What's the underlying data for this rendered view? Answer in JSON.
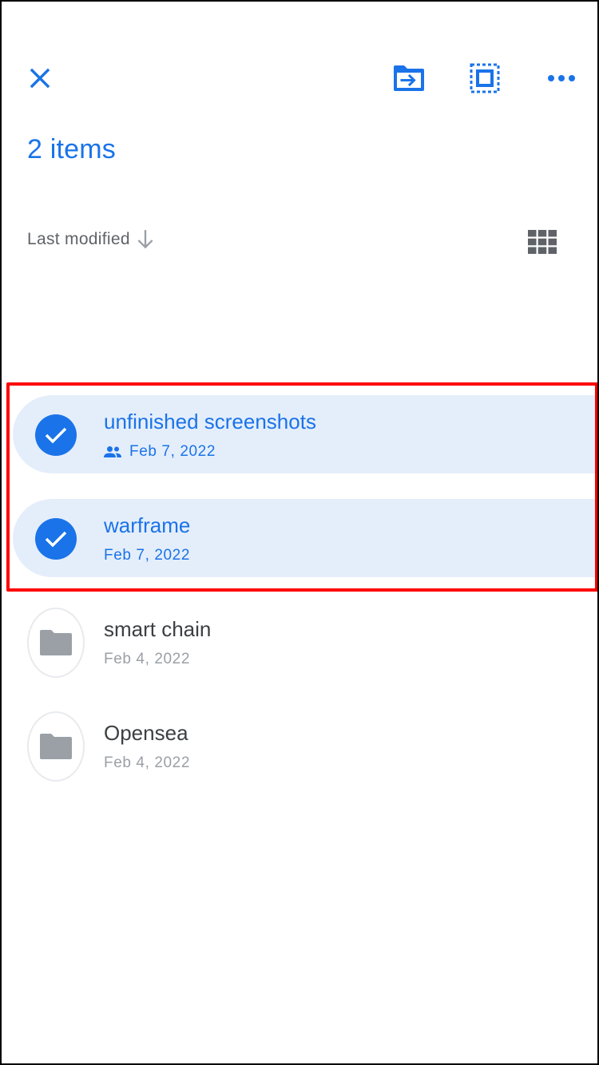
{
  "colors": {
    "accent": "#1a73e8",
    "selected_background": "#e4eefb",
    "highlight_outline": "#ff0000",
    "folder_icon": "#9aa0a6"
  },
  "toolbar": {
    "close_icon": "close-icon",
    "move_icon": "move-to-folder-icon",
    "select_all_icon": "select-all-icon",
    "more_icon": "more-horizontal-icon"
  },
  "header": {
    "items_count": "2 items"
  },
  "sort": {
    "label": "Last modified",
    "direction_icon": "arrow-down-icon",
    "view_icon": "grid-view-icon"
  },
  "files": [
    {
      "name": "unfinished screenshots",
      "date": "Feb 7, 2022",
      "selected": true,
      "shared": true
    },
    {
      "name": "warframe",
      "date": "Feb 7, 2022",
      "selected": true,
      "shared": false
    },
    {
      "name": "smart chain",
      "date": "Feb 4, 2022",
      "selected": false,
      "shared": false
    },
    {
      "name": "Opensea",
      "date": "Feb 4, 2022",
      "selected": false,
      "shared": false
    }
  ]
}
